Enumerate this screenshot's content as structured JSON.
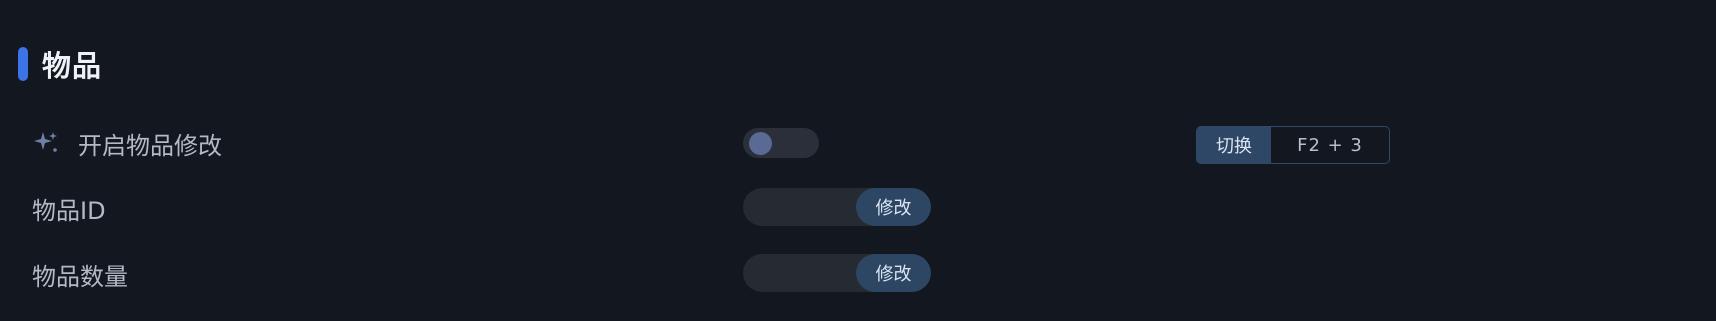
{
  "section": {
    "title": "物品"
  },
  "rows": {
    "enable": {
      "label": "开启物品修改",
      "icon": "sparkle-icon",
      "toggle_on": false,
      "hotkey_label": "切换",
      "hotkey_keys": "F2 + 3"
    },
    "item_id": {
      "label": "物品ID",
      "value": "",
      "button_label": "修改"
    },
    "item_count": {
      "label": "物品数量",
      "value": "",
      "button_label": "修改"
    }
  },
  "colors": {
    "background": "#13171f",
    "accent": "#3b74e6",
    "button": "#2d4664",
    "toggle_knob": "#5b6a94"
  }
}
